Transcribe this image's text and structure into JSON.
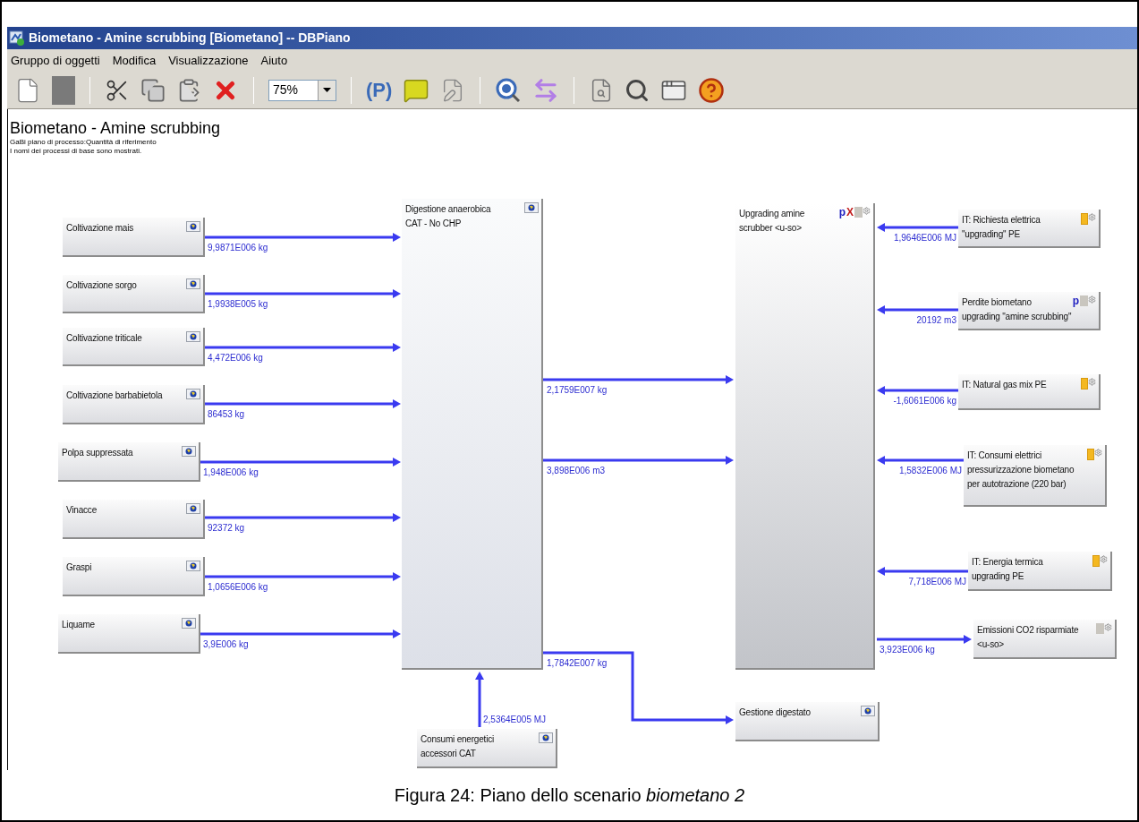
{
  "window": {
    "title": "Biometano - Amine scrubbing [Biometano] -- DBPiano"
  },
  "menu": [
    "Gruppo di oggetti",
    "Modifica",
    "Visualizzazione",
    "Aiuto"
  ],
  "toolbar": {
    "zoom": "75%",
    "plan_label": "(P)"
  },
  "diagram": {
    "title": "Biometano - Amine scrubbing",
    "notes": [
      "GaBi piano di processo:Quantità di riferimento",
      "I nomi dei processi di base sono mostrati."
    ],
    "processes": [
      {
        "name": "Coltivazione mais",
        "kind": "process"
      },
      {
        "name": "Coltivazione sorgo",
        "kind": "process"
      },
      {
        "name": "Coltivazione triticale",
        "kind": "process"
      },
      {
        "name": "Coltivazione barbabietola",
        "kind": "process"
      },
      {
        "name": "Polpa suppressata",
        "kind": "process"
      },
      {
        "name": "Vinacce",
        "kind": "process"
      },
      {
        "name": "Graspi",
        "kind": "process"
      },
      {
        "name": "Liquame",
        "kind": "process"
      },
      {
        "name": [
          "Digestione anaerobica",
          "CAT - No CHP"
        ],
        "kind": "process"
      },
      {
        "name": [
          "Consumi energetici",
          "accessori CAT"
        ],
        "kind": "process"
      },
      {
        "name": [
          "Upgrading amine",
          "scrubber <u-so>"
        ],
        "kind": "plan",
        "markers": [
          {
            "text": "p",
            "kind": "parameter"
          },
          {
            "text": "X",
            "kind": "fixed"
          }
        ]
      },
      {
        "name": "Gestione digestato",
        "kind": "process"
      },
      {
        "name": [
          "IT: Richiesta elettrica",
          "\"upgrading\" PE"
        ],
        "kind": "external"
      },
      {
        "name": [
          "Perdite biometano",
          "upgrading \"amine scrubbing\""
        ],
        "kind": "plan",
        "markers": [
          {
            "text": "p",
            "kind": "parameter"
          }
        ]
      },
      {
        "name": "IT: Natural gas mix PE",
        "kind": "external"
      },
      {
        "name": [
          "IT: Consumi elettrici",
          "pressurizzazione biometano",
          "per autotrazione (220 bar)"
        ],
        "kind": "external"
      },
      {
        "name": [
          "IT: Energia termica",
          "upgrading PE"
        ],
        "kind": "external"
      },
      {
        "name": [
          "Emissioni CO2 risparmiate",
          "<u-so>"
        ],
        "kind": "plan"
      }
    ],
    "flows": [
      {
        "amount": "9,9871E006 kg"
      },
      {
        "amount": "1,9938E005 kg"
      },
      {
        "amount": "4,472E006 kg"
      },
      {
        "amount": "86453 kg"
      },
      {
        "amount": "1,948E006 kg"
      },
      {
        "amount": "92372 kg"
      },
      {
        "amount": "1,0656E006 kg"
      },
      {
        "amount": "3,9E006 kg"
      },
      {
        "amount": "2,5364E005 MJ"
      },
      {
        "amount": "2,1759E007 kg"
      },
      {
        "amount": "3,898E006 m3"
      },
      {
        "amount": "1,7842E007 kg"
      },
      {
        "amount": "1,9646E006 MJ"
      },
      {
        "amount": "20192 m3"
      },
      {
        "amount": "-1,6061E006 kg"
      },
      {
        "amount": "1,5832E006 MJ"
      },
      {
        "amount": "7,718E006 MJ"
      },
      {
        "amount": "3,923E006 kg"
      }
    ]
  },
  "caption": "Figura 24: Piano dello scenario *biometano 2*"
}
